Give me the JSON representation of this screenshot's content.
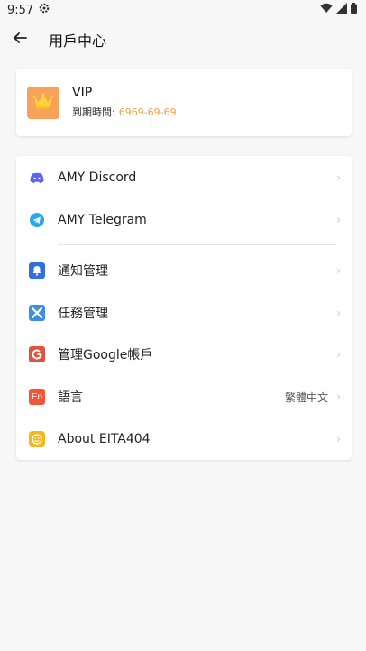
{
  "status": {
    "time": "9:57"
  },
  "header": {
    "title": "用戶中心"
  },
  "vip": {
    "title": "VIP",
    "expire_label": "到期時間:",
    "expire_date": "6969-69-69"
  },
  "menu": {
    "items": [
      {
        "label": "AMY Discord",
        "icon": "discord-icon",
        "color": "#5865f2"
      },
      {
        "label": "AMY Telegram",
        "icon": "telegram-icon",
        "color": "#2aa8e6"
      },
      {
        "label": "通知管理",
        "icon": "bell-icon",
        "color": "#2f6fe0"
      },
      {
        "label": "任務管理",
        "icon": "tools-icon",
        "color": "#3d8ee8"
      },
      {
        "label": "管理Google帳戶",
        "icon": "google-icon",
        "color": "#e0533f"
      },
      {
        "label": "語言",
        "icon": "language-icon",
        "color": "#f0573a",
        "icon_text": "En",
        "value": "繁體中文"
      },
      {
        "label": "About EITA404",
        "icon": "smiley-icon",
        "color": "#f5b71b"
      }
    ]
  }
}
